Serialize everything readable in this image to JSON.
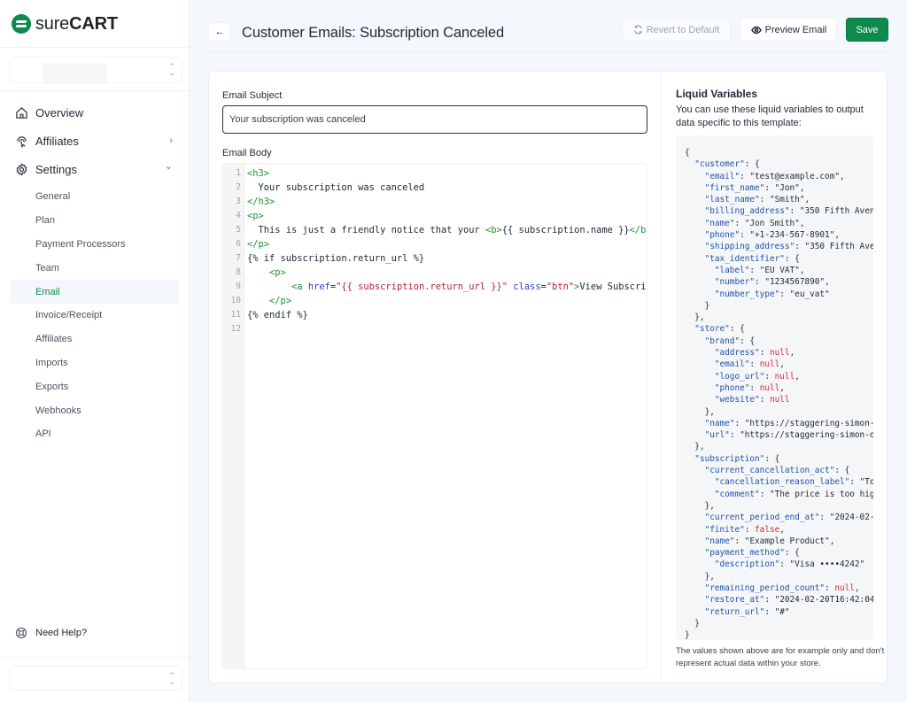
{
  "brand": {
    "logo_light": "sure",
    "logo_bold": "CART",
    "accent": "#0e8a4f"
  },
  "sidebar": {
    "main_items": [
      {
        "label": "Overview",
        "icon": "home-icon"
      },
      {
        "label": "Affiliates",
        "icon": "fingerprint-cursor-icon",
        "chevron": "›"
      },
      {
        "label": "Settings",
        "icon": "gear-icon",
        "chevron": "⌄"
      }
    ],
    "settings_items": [
      {
        "label": "General"
      },
      {
        "label": "Plan"
      },
      {
        "label": "Payment Processors"
      },
      {
        "label": "Team"
      },
      {
        "label": "Email",
        "active": true
      },
      {
        "label": "Invoice/Receipt"
      },
      {
        "label": "Affiliates"
      },
      {
        "label": "Imports"
      },
      {
        "label": "Exports"
      },
      {
        "label": "Webhooks"
      },
      {
        "label": "API"
      }
    ],
    "help_label": "Need Help?"
  },
  "header": {
    "back_label": "←",
    "title": "Customer Emails: Subscription Canceled",
    "revert_label": "Revert to Default",
    "preview_label": "Preview Email",
    "save_label": "Save"
  },
  "form": {
    "subject_label": "Email Subject",
    "subject_value": "Your subscription was canceled",
    "body_label": "Email Body",
    "body_lines": [
      "<h3>",
      "  Your subscription was canceled",
      "</h3>",
      "<p>",
      "  This is just a friendly notice that your <b>{{ subscription.name }}</b>",
      "</p>",
      "{% if subscription.return_url %}",
      "    <p>",
      "        <a href=\"{{ subscription.return_url }}\" class=\"btn\">View Subscription</a>",
      "    </p>",
      "{% endif %}",
      ""
    ]
  },
  "liquid": {
    "title": "Liquid Variables",
    "description": "You can use these liquid variables to output data specific to this template:",
    "note": "The values shown above are for example only and don't represent actual data within your store.",
    "variables": {
      "customer": {
        "email": "test@example.com",
        "first_name": "Jon",
        "last_name": "Smith",
        "billing_address": "350 Fifth Aven",
        "name": "Jon Smith",
        "phone": "+1-234-567-8901",
        "shipping_address": "350 Fifth Ave",
        "tax_identifier": {
          "label": "EU VAT",
          "number": "1234567890",
          "number_type": "eu_vat"
        }
      },
      "store": {
        "brand": {
          "address": null,
          "email": null,
          "logo_url": null,
          "phone": null,
          "website": null
        },
        "name": "https://staggering-simon-",
        "url": "https://staggering-simon-o"
      },
      "subscription": {
        "current_cancellation_act": {
          "cancellation_reason_label": "To",
          "comment": "The price is too hig"
        },
        "current_period_end_at": "2024-02-",
        "finite": false,
        "name": "Example Product",
        "payment_method": {
          "description": "Visa ••••4242"
        },
        "remaining_period_count": null,
        "restore_at": "2024-02-20T16:42:04",
        "return_url": "#"
      }
    }
  }
}
